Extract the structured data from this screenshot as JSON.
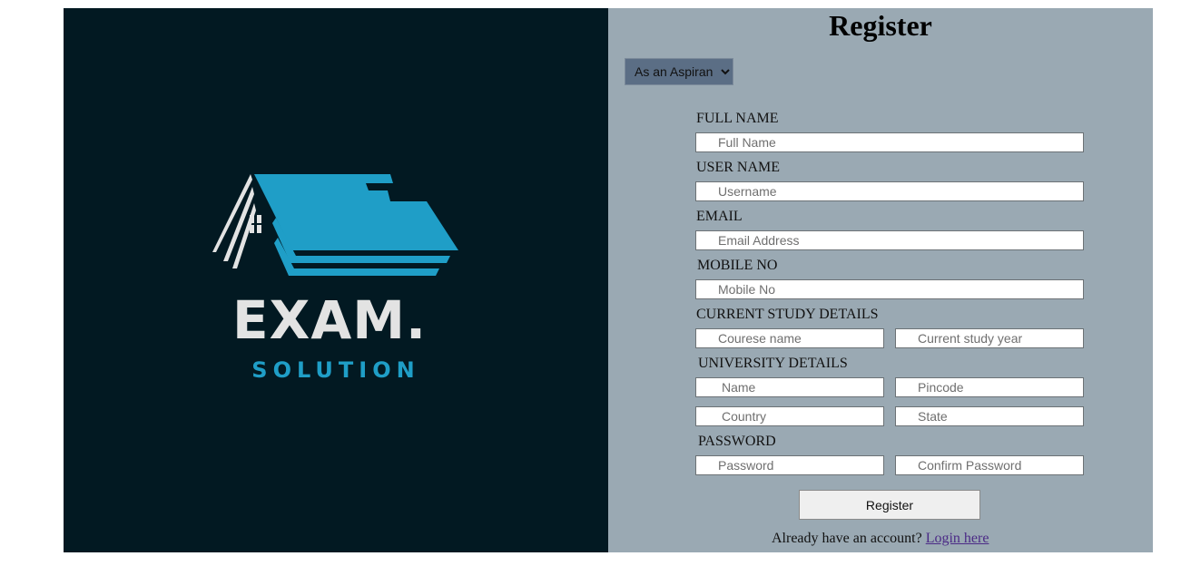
{
  "brand": {
    "name": "EXAM.",
    "tagline": "SOLUTION",
    "colors": {
      "background": "#021922",
      "accent": "#1f9ec7",
      "text": "#e3e3e3"
    }
  },
  "form": {
    "title": "Register",
    "role_select": {
      "selected": "As an Aspirant",
      "options": [
        "As an Aspirant"
      ]
    },
    "labels": {
      "full_name": "FULL NAME",
      "user_name": "USER NAME",
      "email": "EMAIL",
      "mobile": "MOBILE NO",
      "study": "CURRENT STUDY DETAILS",
      "university": "UNIVERSITY DETAILS",
      "password": "PASSWORD"
    },
    "placeholders": {
      "full_name": "Full Name",
      "username": "Username",
      "email": "Email Address",
      "mobile": "Mobile No",
      "course": "Courese name",
      "study_year": "Current study year",
      "uni_name": "Name",
      "pincode": "Pincode",
      "country": "Country",
      "state": "State",
      "password": "Password",
      "confirm_password": "Confirm Password"
    },
    "submit_label": "Register",
    "footer_text": "Already have an account? ",
    "login_link": "Login here"
  }
}
